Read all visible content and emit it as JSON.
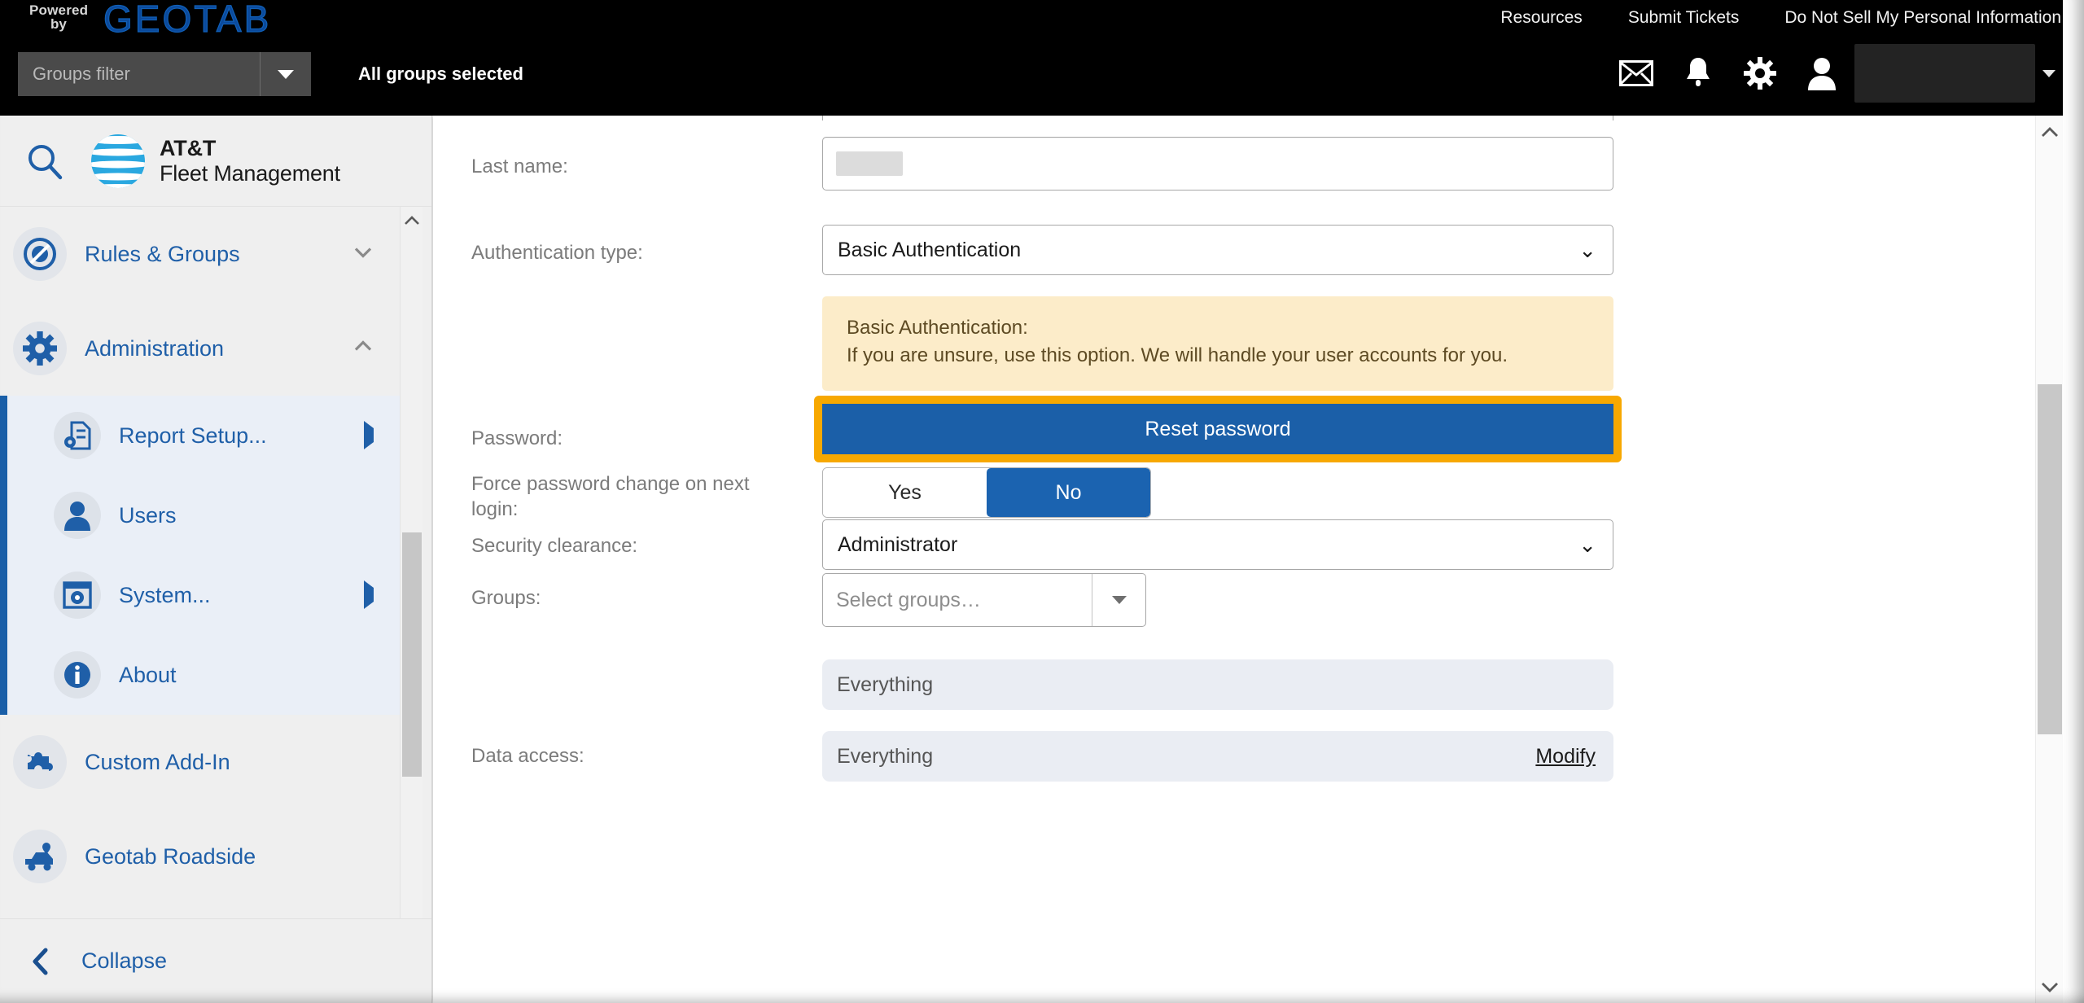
{
  "header": {
    "powered_line1": "Powered",
    "powered_line2": "by",
    "brand": "GEOTAB",
    "links": [
      "Resources",
      "Submit Tickets",
      "Do Not Sell My Personal Information"
    ],
    "groups_filter_placeholder": "Groups filter",
    "groups_status": "All groups selected",
    "icons": [
      "mail-icon",
      "bell-icon",
      "gear-icon",
      "user-icon"
    ],
    "user_name_redacted": ""
  },
  "sidebar": {
    "product_name_line1": "AT&T",
    "product_name_line2": "Fleet Management",
    "search_label": "Search",
    "items": [
      {
        "label": "Rules & Groups",
        "icon": "rules-icon",
        "expanded": false,
        "chevron": "chevron-down-icon"
      },
      {
        "label": "Administration",
        "icon": "gear-icon",
        "expanded": true,
        "chevron": "chevron-up-icon"
      }
    ],
    "submenu": [
      {
        "label": "Report Setup...",
        "icon": "report-setup-icon",
        "has_flyout": true
      },
      {
        "label": "Users",
        "icon": "user-icon",
        "has_flyout": false
      },
      {
        "label": "System...",
        "icon": "system-icon",
        "has_flyout": true
      },
      {
        "label": "About",
        "icon": "info-icon",
        "has_flyout": false
      }
    ],
    "items_after": [
      {
        "label": "Custom Add-In",
        "icon": "puzzle-icon"
      },
      {
        "label": "Geotab Roadside",
        "icon": "roadside-icon"
      }
    ],
    "collapse_label": "Collapse",
    "collapse_icon": "chevron-left-icon"
  },
  "form": {
    "last_name": {
      "label": "Last name:",
      "value": ""
    },
    "authentication_type": {
      "label": "Authentication type:",
      "value": "Basic Authentication",
      "options": [
        "Basic Authentication"
      ]
    },
    "auth_info": {
      "title": "Basic Authentication:",
      "body": "If you are unsure, use this option. We will handle your user accounts for you."
    },
    "password": {
      "label": "Password:",
      "button_label": "Reset password"
    },
    "force_password_change": {
      "label": "Force password change on next login:",
      "options": [
        "Yes",
        "No"
      ],
      "selected": "No"
    },
    "security_clearance": {
      "label": "Security clearance:",
      "value": "Administrator",
      "options": [
        "Administrator"
      ]
    },
    "groups": {
      "label": "Groups:",
      "placeholder": "Select groups…",
      "value": "",
      "selected_chip": "Everything"
    },
    "data_access": {
      "label": "Data access:",
      "value": "Everything",
      "action_label": "Modify"
    }
  },
  "colors": {
    "accent_blue": "#1b5fa8",
    "highlight_orange": "#f7a800",
    "info_bg": "#fcecc9",
    "sidebar_bg": "#efefef",
    "submenu_bg": "#eaeff7",
    "chip_bg": "#eaedf3"
  }
}
